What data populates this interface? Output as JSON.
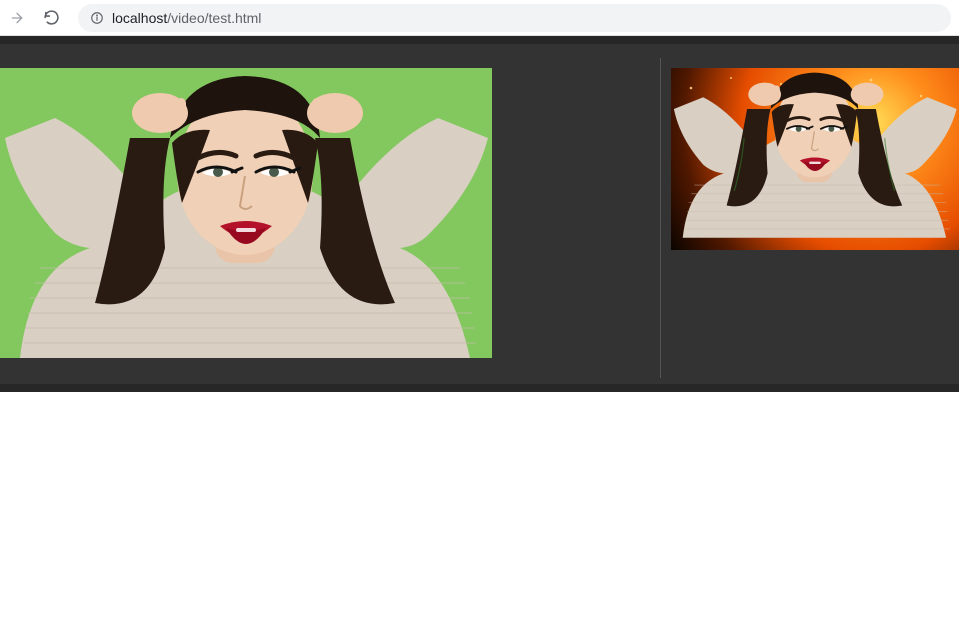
{
  "browser": {
    "nav": {
      "back_label": "Back",
      "forward_label": "Forward",
      "reload_label": "Reload"
    },
    "omnibox": {
      "security_label": "Not secure",
      "host": "localhost",
      "path": "/video/test.html"
    }
  },
  "page": {
    "left_image": {
      "description": "Person with dark hair, hands behind head, wearing light knit sweater, green-screen background",
      "background_color": "#82c85f"
    },
    "right_image": {
      "description": "Same person composited over fiery orange explosion background",
      "background_style": "fire-gradient"
    }
  },
  "icons": {
    "forward": "forward-arrow-icon",
    "reload": "reload-icon",
    "info": "info-icon"
  }
}
